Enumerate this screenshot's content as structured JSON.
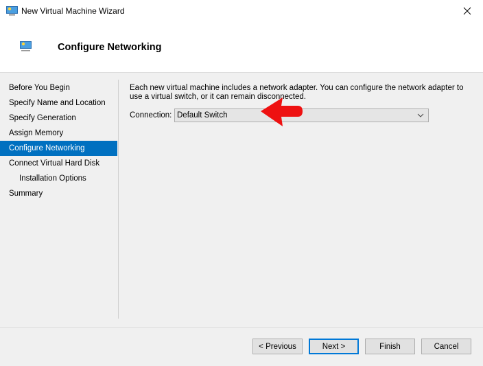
{
  "window": {
    "title": "New Virtual Machine Wizard",
    "close_icon": "close-icon"
  },
  "header": {
    "title": "Configure Networking",
    "icon": "monitor-icon"
  },
  "nav": {
    "items": [
      {
        "label": "Before You Begin",
        "active": false,
        "sub": false
      },
      {
        "label": "Specify Name and Location",
        "active": false,
        "sub": false
      },
      {
        "label": "Specify Generation",
        "active": false,
        "sub": false
      },
      {
        "label": "Assign Memory",
        "active": false,
        "sub": false
      },
      {
        "label": "Configure Networking",
        "active": true,
        "sub": false
      },
      {
        "label": "Connect Virtual Hard Disk",
        "active": false,
        "sub": false
      },
      {
        "label": "Installation Options",
        "active": false,
        "sub": true
      },
      {
        "label": "Summary",
        "active": false,
        "sub": false
      }
    ]
  },
  "content": {
    "description": "Each new virtual machine includes a network adapter. You can configure the network adapter to use a virtual switch, or it can remain disconnected.",
    "connection_label": "Connection:",
    "connection_value": "Default Switch"
  },
  "annotation": {
    "arrow_color": "#ee1111"
  },
  "buttons": {
    "previous": "< Previous",
    "next": "Next >",
    "finish": "Finish",
    "cancel": "Cancel"
  },
  "colors": {
    "accent": "#0070c0",
    "default_button_border": "#0078d7"
  }
}
